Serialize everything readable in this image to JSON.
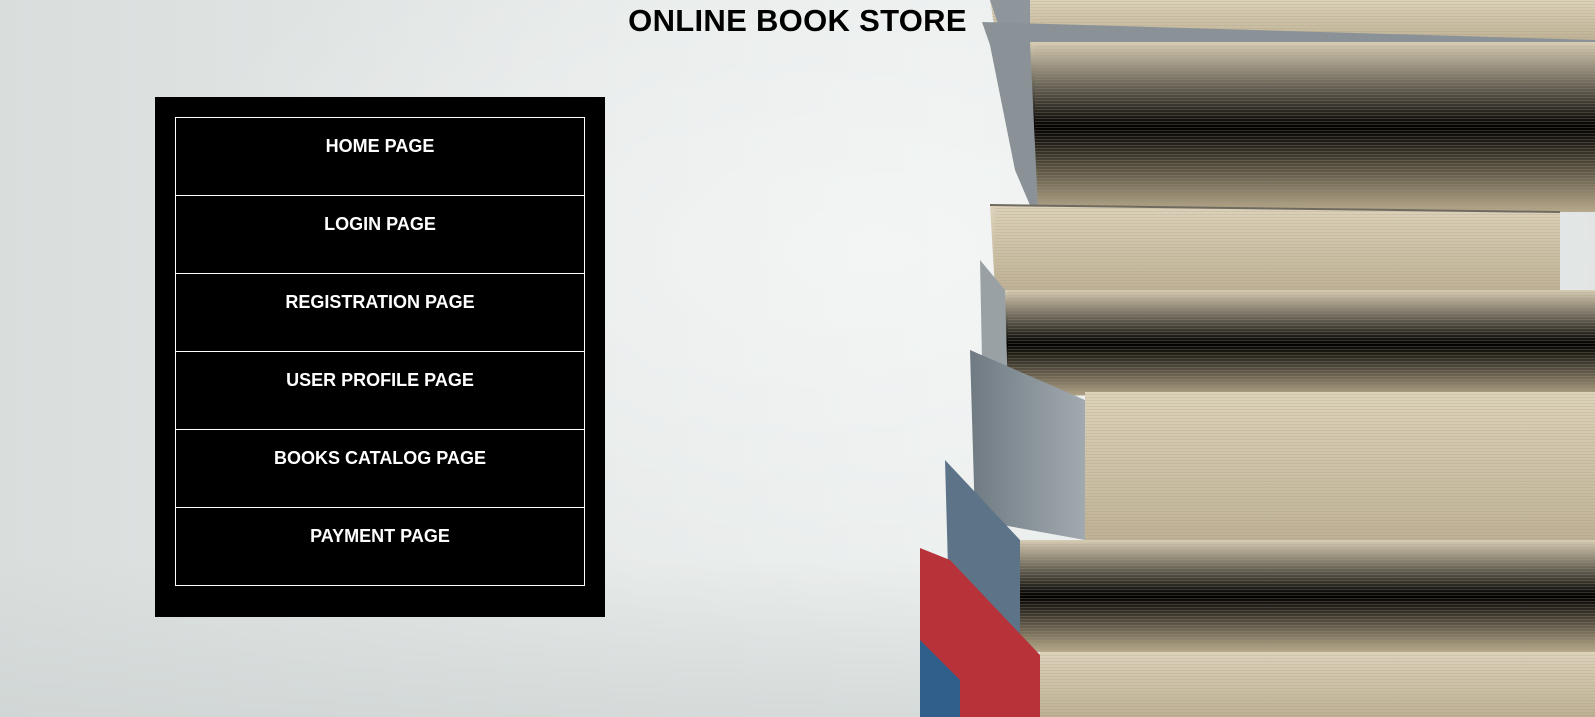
{
  "header": {
    "title": "ONLINE BOOK STORE"
  },
  "nav": {
    "items": [
      {
        "label": "HOME PAGE"
      },
      {
        "label": "LOGIN PAGE"
      },
      {
        "label": "REGISTRATION PAGE"
      },
      {
        "label": "USER PROFILE PAGE"
      },
      {
        "label": "BOOKS CATALOG PAGE"
      },
      {
        "label": "PAYMENT PAGE"
      }
    ]
  },
  "colors": {
    "nav_background": "#000000",
    "nav_text": "#ffffff",
    "nav_border": "#ffffff",
    "title_text": "#000000"
  }
}
